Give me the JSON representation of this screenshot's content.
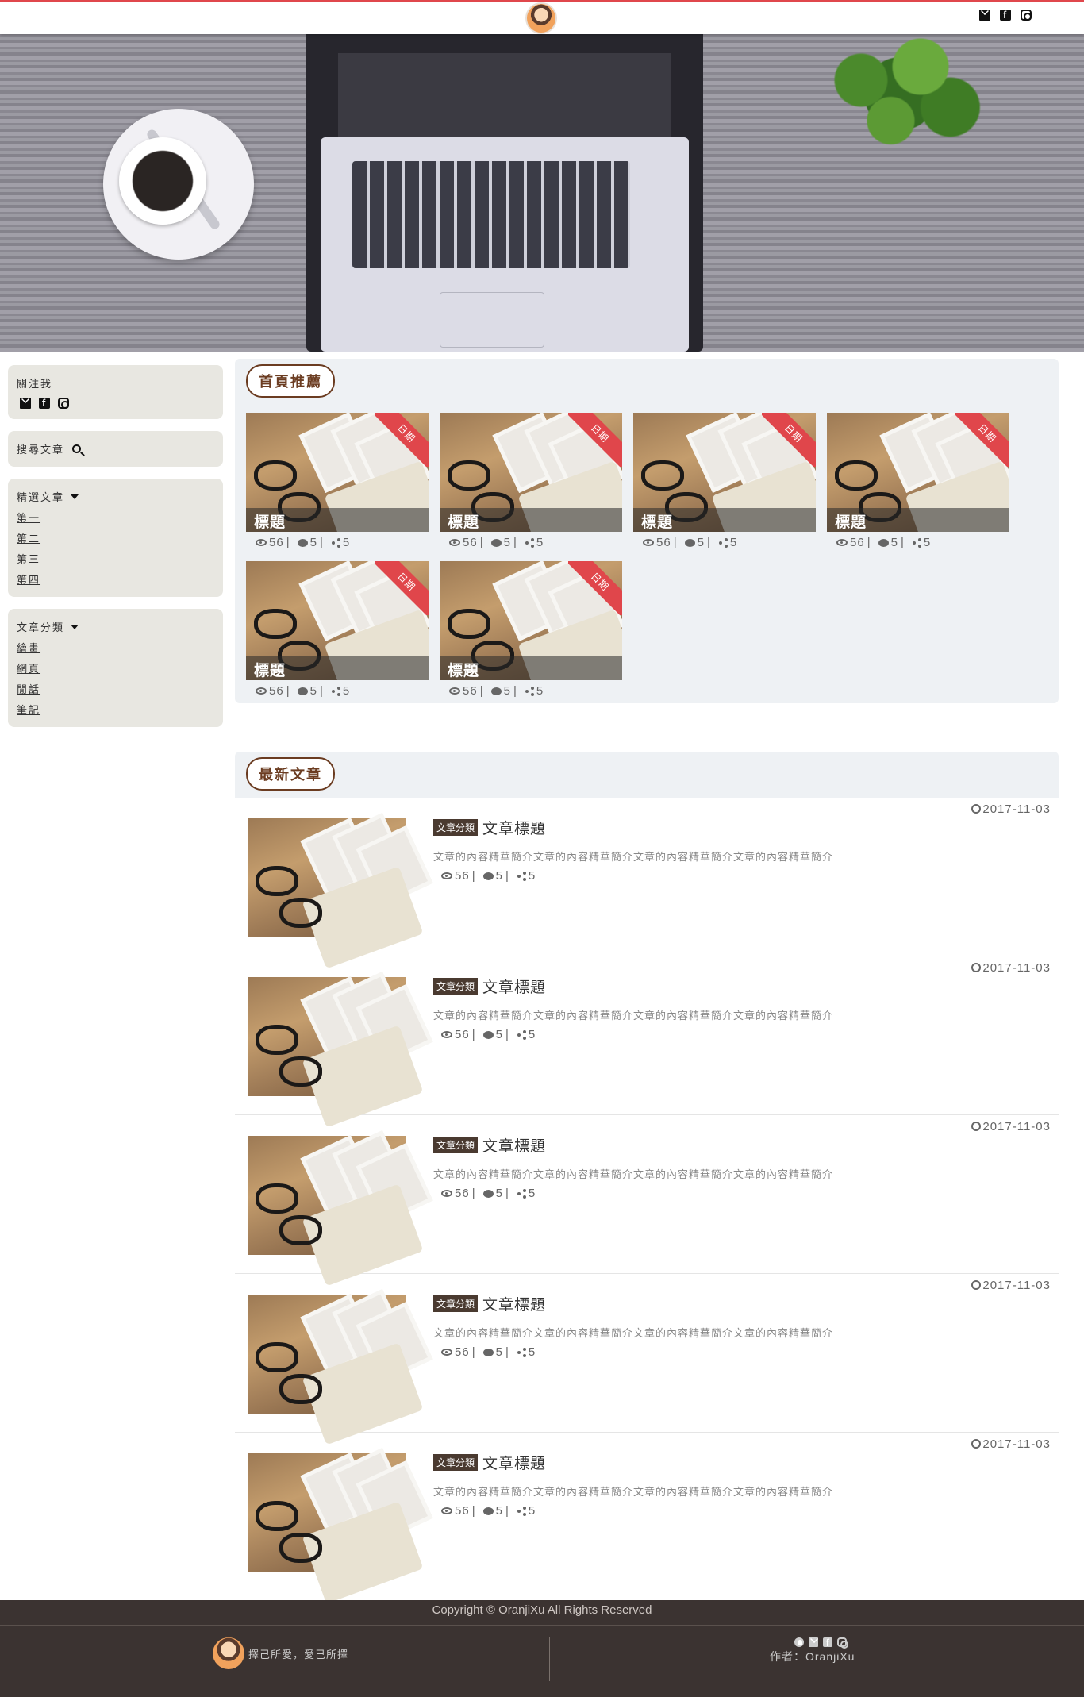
{
  "header": {
    "icons": [
      "mail-icon",
      "facebook-icon",
      "instagram-icon"
    ]
  },
  "sidebar": {
    "follow_label": "關注我",
    "search_label": "搜尋文章",
    "featured_label": "精選文章",
    "featured_items": [
      "第一",
      "第二",
      "第三",
      "第四"
    ],
    "category_label": "文章分類",
    "category_items": [
      "繪畫",
      "網頁",
      "閒話",
      "筆記"
    ]
  },
  "recommended": {
    "title": "首頁推薦",
    "cards": [
      {
        "caption": "標題",
        "ribbon": "日期",
        "views": "56",
        "comments": "5",
        "shares": "5"
      },
      {
        "caption": "標題",
        "ribbon": "日期",
        "views": "56",
        "comments": "5",
        "shares": "5"
      },
      {
        "caption": "標題",
        "ribbon": "日期",
        "views": "56",
        "comments": "5",
        "shares": "5"
      },
      {
        "caption": "標題",
        "ribbon": "日期",
        "views": "56",
        "comments": "5",
        "shares": "5"
      },
      {
        "caption": "標題",
        "ribbon": "日期",
        "views": "56",
        "comments": "5",
        "shares": "5"
      },
      {
        "caption": "標題",
        "ribbon": "日期",
        "views": "56",
        "comments": "5",
        "shares": "5"
      }
    ]
  },
  "latest": {
    "title": "最新文章",
    "posts": [
      {
        "date": "2017-11-03",
        "category": "文章分類",
        "title": "文章標題",
        "desc": "文章的內容精華簡介文章的內容精華簡介文章的內容精華簡介文章的內容精華簡介",
        "views": "56",
        "comments": "5",
        "shares": "5"
      },
      {
        "date": "2017-11-03",
        "category": "文章分類",
        "title": "文章標題",
        "desc": "文章的內容精華簡介文章的內容精華簡介文章的內容精華簡介文章的內容精華簡介",
        "views": "56",
        "comments": "5",
        "shares": "5"
      },
      {
        "date": "2017-11-03",
        "category": "文章分類",
        "title": "文章標題",
        "desc": "文章的內容精華簡介文章的內容精華簡介文章的內容精華簡介文章的內容精華簡介",
        "views": "56",
        "comments": "5",
        "shares": "5"
      },
      {
        "date": "2017-11-03",
        "category": "文章分類",
        "title": "文章標題",
        "desc": "文章的內容精華簡介文章的內容精華簡介文章的內容精華簡介文章的內容精華簡介",
        "views": "56",
        "comments": "5",
        "shares": "5"
      },
      {
        "date": "2017-11-03",
        "category": "文章分類",
        "title": "文章標題",
        "desc": "文章的內容精華簡介文章的內容精華簡介文章的內容精華簡介文章的內容精華簡介",
        "views": "56",
        "comments": "5",
        "shares": "5"
      }
    ]
  },
  "footer": {
    "copyright": "Copyright © OranjiXu All Rights Reserved",
    "slogan": "擇己所愛，愛己所擇",
    "author": "作者：OranjiXu"
  },
  "colors": {
    "accent": "#e0474c",
    "brown": "#6b3c21",
    "footer_bg": "#3b3331"
  }
}
